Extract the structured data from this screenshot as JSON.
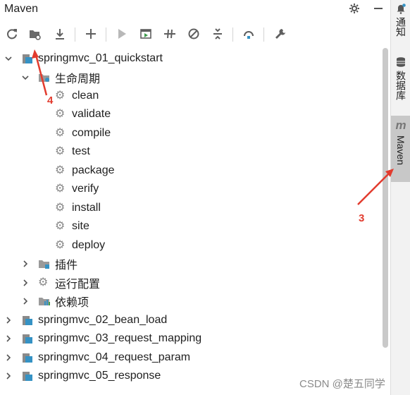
{
  "header": {
    "title": "Maven"
  },
  "colors": {
    "icon": "#6e6e6e",
    "accent": "#3592c4",
    "annotation": "#e23b2e",
    "active_tab": "#c8c8c8"
  },
  "toolbar": {
    "icons": [
      "reload-icon",
      "add-project-folder-icon",
      "download-icon",
      "plus-icon",
      "run-icon",
      "run-config-icon",
      "toggle-offline-icon",
      "skip-tests-icon",
      "collapse-all-icon",
      "show-dependencies-icon",
      "settings-wrench-icon"
    ]
  },
  "tree": {
    "project1": "springmvc_01_quickstart",
    "lifecycle": "生命周期",
    "phases": [
      "clean",
      "validate",
      "compile",
      "test",
      "package",
      "verify",
      "install",
      "site",
      "deploy"
    ],
    "plugins": "插件",
    "run_configs": "运行配置",
    "dependencies": "依赖项",
    "projects": [
      "springmvc_02_bean_load",
      "springmvc_03_request_mapping",
      "springmvc_04_request_param",
      "springmvc_05_response"
    ]
  },
  "side_tabs": {
    "notifications": "通知",
    "database": "数据库",
    "maven": "Maven",
    "maven_glyph": "m"
  },
  "annotations": {
    "arrow4_label": "4",
    "arrow3_label": "3"
  },
  "watermark": "CSDN @楚五同学"
}
